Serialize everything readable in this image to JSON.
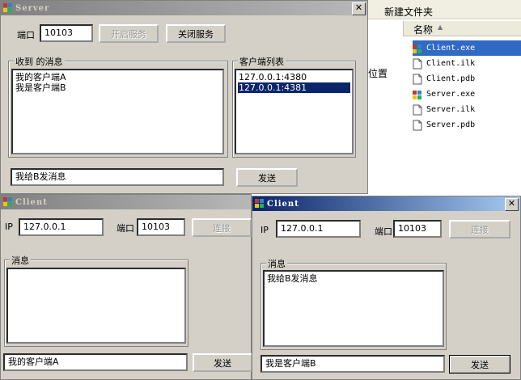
{
  "explorer": {
    "menu_item": "新建文件夹",
    "column_header": "名称",
    "sort_indicator": "▲",
    "side_text": "位置",
    "files": [
      "Client.exe",
      "Client.ilk",
      "Client.pdb",
      "Server.exe",
      "Server.ilk",
      "Server.pdb"
    ],
    "file_icons": [
      "exe-icon",
      "document-icon",
      "document-icon",
      "exe-icon",
      "document-icon",
      "document-icon"
    ]
  },
  "server": {
    "title": "Server",
    "close": "✕",
    "port_label": "端口",
    "port_value": "10103",
    "start_label": "开启服务",
    "stop_label": "关闭服务",
    "received_title": "收到 的消息",
    "received": [
      "我的客户端A",
      "我是客户端B"
    ],
    "clients_title": "客户端列表",
    "clients": [
      "127.0.0.1:4380",
      "127.0.0.1:4381"
    ],
    "selected_client_index": 1,
    "message_value": "我给B发消息",
    "send_label": "发送"
  },
  "client_a": {
    "title": "Client",
    "ip_label": "IP",
    "ip_value": "127.0.0.1",
    "port_label": "端口",
    "port_value": "10103",
    "connect_label": "连接",
    "messages_title": "消息",
    "messages": [],
    "input_value": "我的客户端A",
    "send_label": "发送"
  },
  "client_b": {
    "title": "Client",
    "close": "✕",
    "ip_label": "IP",
    "ip_value": "127.0.0.1",
    "port_label": "端口",
    "port_value": "10103",
    "connect_label": "连接",
    "messages_title": "消息",
    "messages": [
      "我给B发消息"
    ],
    "input_value": "我是客户端B",
    "send_label": "发送"
  },
  "colors": {
    "dialog_face": "#d4d0c8",
    "active_title": "#0a246a",
    "selection": "#0a246a"
  }
}
